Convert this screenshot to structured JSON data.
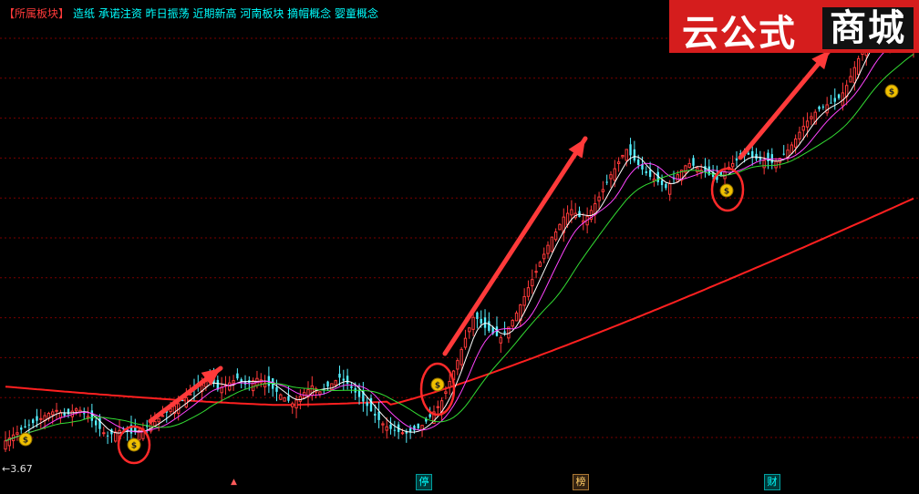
{
  "header": {
    "bracket_label": "【所属板块】",
    "sectors": [
      "造纸",
      "承诺注资",
      "昨日振荡",
      "近期新高",
      "河南板块",
      "摘帽概念",
      "婴童概念"
    ]
  },
  "brand": {
    "part1": "云公式",
    "part2": "商城"
  },
  "min_price_label": "←3.67",
  "markers": {
    "ting": "停",
    "bang": "榜",
    "cai": "财",
    "up": "▲"
  },
  "colors": {
    "background": "#000000",
    "up_candle": "#ff3a3a",
    "down_candle": "#54f0ff",
    "ma_white": "#ffffff",
    "ma_magenta": "#ff44ff",
    "ma_green": "#33dd33",
    "ma_long_red": "#ff2020",
    "circle": "#ff2a2a",
    "arrow": "#ff3a3a",
    "grid": "#7a0000"
  },
  "chart_data": {
    "type": "candlestick",
    "ylim": [
      3.3,
      9.6
    ],
    "min_price": 3.67,
    "close": [
      3.72,
      3.76,
      3.8,
      3.83,
      3.87,
      3.9,
      3.94,
      3.96,
      3.99,
      4.02,
      4.06,
      4.09,
      4.11,
      4.13,
      4.1,
      4.06,
      4.08,
      4.12,
      4.15,
      4.13,
      4.09,
      4.05,
      3.99,
      3.93,
      3.88,
      3.83,
      3.79,
      3.81,
      3.84,
      3.86,
      3.88,
      3.85,
      3.82,
      3.84,
      3.86,
      3.88,
      3.91,
      3.95,
      3.98,
      4.02,
      4.06,
      4.1,
      4.15,
      4.19,
      4.22,
      4.26,
      4.3,
      4.35,
      4.4,
      4.44,
      4.47,
      4.52,
      4.57,
      4.49,
      4.41,
      4.44,
      4.47,
      4.5,
      4.53,
      4.56,
      4.52,
      4.48,
      4.5,
      4.53,
      4.56,
      4.54,
      4.5,
      4.46,
      4.42,
      4.38,
      4.34,
      4.3,
      4.26,
      4.22,
      4.27,
      4.32,
      4.37,
      4.41,
      4.46,
      4.42,
      4.38,
      4.41,
      4.45,
      4.49,
      4.53,
      4.57,
      4.53,
      4.49,
      4.43,
      4.37,
      4.31,
      4.25,
      4.19,
      4.12,
      4.06,
      4.0,
      3.95,
      3.91,
      3.88,
      3.86,
      3.84,
      3.83,
      3.82,
      3.84,
      3.86,
      3.89,
      3.93,
      3.98,
      4.04,
      4.11,
      4.18,
      4.26,
      4.38,
      4.52,
      4.66,
      4.8,
      4.95,
      5.1,
      5.24,
      5.38,
      5.36,
      5.3,
      5.24,
      5.2,
      5.16,
      5.13,
      5.11,
      5.17,
      5.25,
      5.34,
      5.44,
      5.55,
      5.66,
      5.78,
      5.89,
      6.0,
      6.12,
      6.23,
      6.35,
      6.46,
      6.53,
      6.63,
      6.73,
      6.78,
      6.83,
      6.78,
      6.73,
      6.68,
      6.74,
      6.82,
      6.91,
      7.0,
      7.1,
      7.2,
      7.3,
      7.38,
      7.47,
      7.56,
      7.64,
      7.56,
      7.49,
      7.43,
      7.37,
      7.32,
      7.27,
      7.24,
      7.2,
      7.16,
      7.12,
      7.18,
      7.24,
      7.3,
      7.36,
      7.42,
      7.45,
      7.42,
      7.39,
      7.36,
      7.33,
      7.3,
      7.27,
      7.23,
      7.29,
      7.34,
      7.4,
      7.45,
      7.49,
      7.53,
      7.55,
      7.57,
      7.54,
      7.51,
      7.5,
      7.49,
      7.48,
      7.46,
      7.48,
      7.52,
      7.57,
      7.63,
      7.7,
      7.78,
      7.87,
      7.95,
      8.02,
      8.08,
      8.14,
      8.18,
      8.21,
      8.24,
      8.26,
      8.28,
      8.33,
      8.4,
      8.5,
      8.62,
      8.74,
      8.86,
      8.98,
      9.07,
      9.14,
      9.12,
      9.09,
      9.07,
      9.05,
      9.03,
      9.03,
      9.06,
      9.1,
      9.12,
      9.08,
      9.06
    ]
  }
}
